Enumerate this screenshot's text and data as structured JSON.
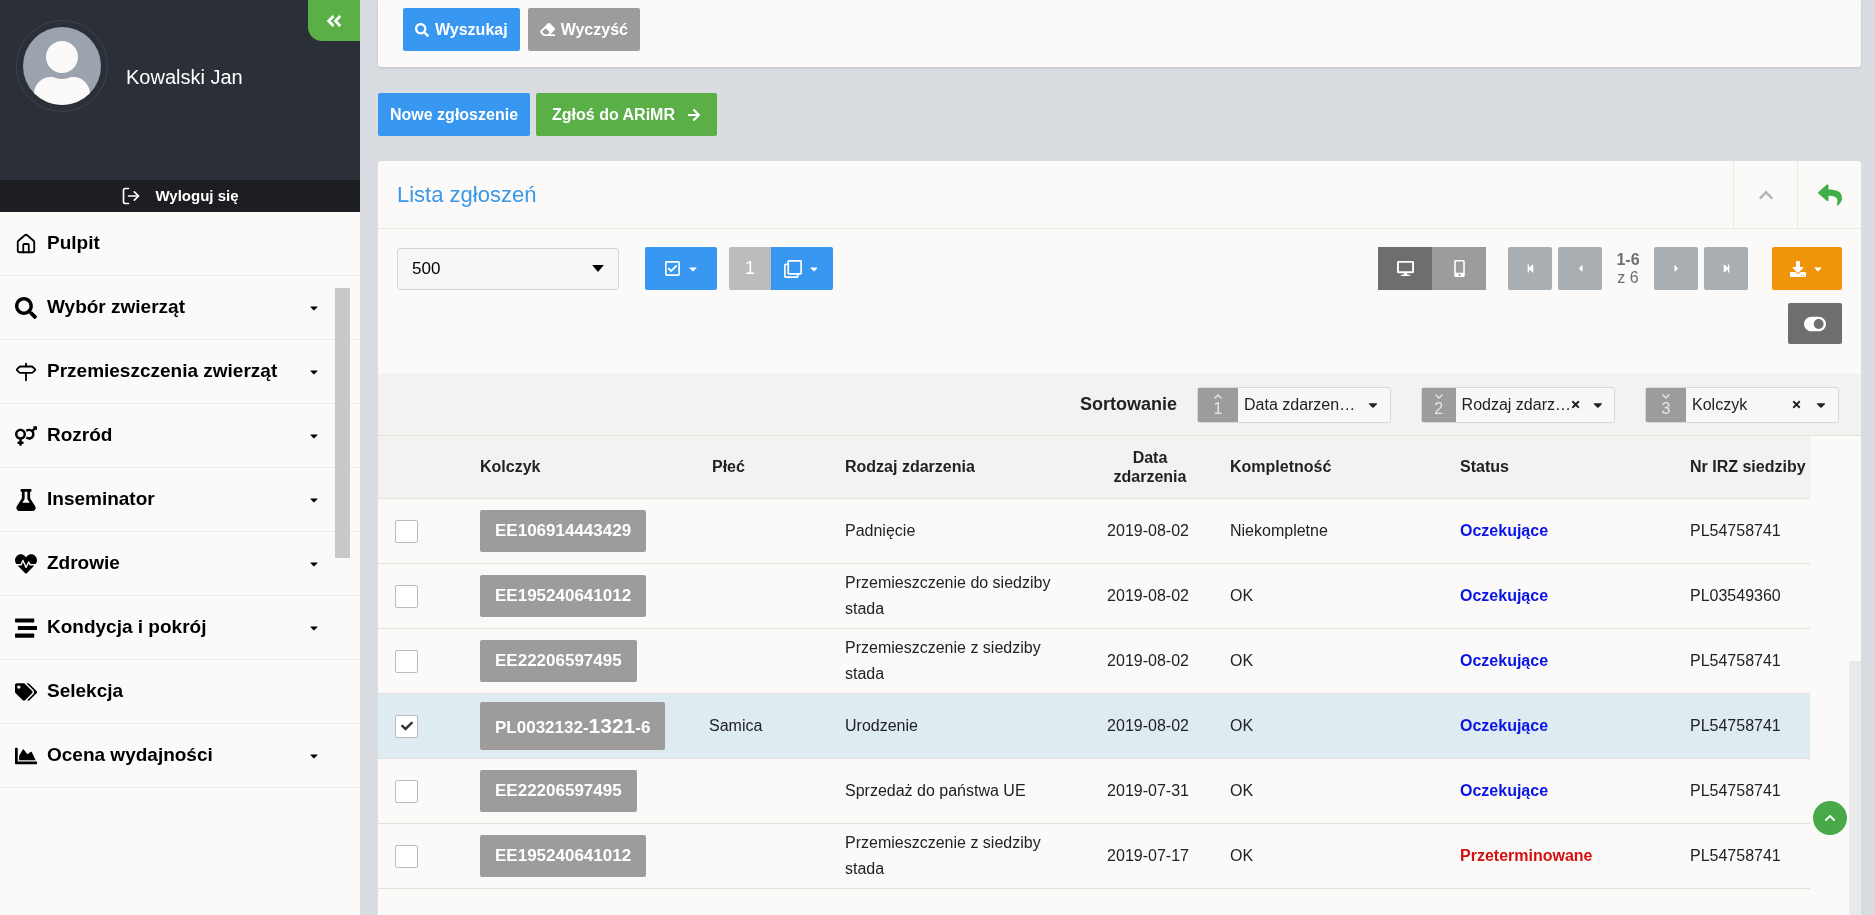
{
  "sidebar": {
    "user_name": "Kowalski Jan",
    "logout": "Wyloguj się",
    "items": [
      {
        "label": "Pulpit",
        "has_submenu": false
      },
      {
        "label": "Wybór zwierząt",
        "has_submenu": true
      },
      {
        "label": "Przemieszczenia zwierząt",
        "has_submenu": true
      },
      {
        "label": "Rozród",
        "has_submenu": true
      },
      {
        "label": "Inseminator",
        "has_submenu": true
      },
      {
        "label": "Zdrowie",
        "has_submenu": true
      },
      {
        "label": "Kondycja i pokrój",
        "has_submenu": true
      },
      {
        "label": "Selekcja",
        "has_submenu": false
      },
      {
        "label": "Ocena wydajności",
        "has_submenu": true
      }
    ]
  },
  "search_buttons": [
    "Wyszukaj",
    "Wyczyść"
  ],
  "actions": [
    "Nowe zgłoszenie",
    "Zgłoś do ARiMR"
  ],
  "panel": {
    "title": "Lista zgłoszeń",
    "page_size": "500",
    "selected_count": "1",
    "views": [
      {
        "selected": true
      },
      {
        "selected": false
      }
    ],
    "page_range": "1-6",
    "page_total": "z 6",
    "sort_label": "Sortowanie",
    "sorts": [
      {
        "number": "1",
        "ascending": true,
        "label": "Data zdarzen…",
        "clearable": false
      },
      {
        "number": "2",
        "ascending": false,
        "label": "Rodzaj zdarz…",
        "clearable": true
      },
      {
        "number": "3",
        "ascending": false,
        "label": "Kolczyk",
        "clearable": true
      }
    ],
    "columns": [
      "Kolczyk",
      "Płeć",
      "Rodzaj zdarzenia",
      "Data zdarzenia",
      "Kompletność",
      "Status",
      "Nr IRZ siedziby"
    ],
    "rows": [
      {
        "selected": false,
        "tag": "EE106914443429",
        "sex": "",
        "event": "Padnięcie",
        "date": "2019-08-02",
        "completeness": "Niekompletne",
        "status": "Oczekujące",
        "overdue": false,
        "irz": "PL54758741"
      },
      {
        "selected": false,
        "tag": "EE195240641012",
        "sex": "",
        "event": "Przemieszczenie do siedziby stada",
        "date": "2019-08-02",
        "completeness": "OK",
        "status": "Oczekujące",
        "overdue": false,
        "irz": "PL03549360"
      },
      {
        "selected": false,
        "tag": "EE22206597495",
        "sex": "",
        "event": "Przemieszczenie z siedziby stada",
        "date": "2019-08-02",
        "completeness": "OK",
        "status": "Oczekujące",
        "overdue": false,
        "irz": "PL54758741"
      },
      {
        "selected": true,
        "tag": "PL0032132-**1321**-6",
        "sex": "Samica",
        "event": "Urodzenie",
        "date": "2019-08-02",
        "completeness": "OK",
        "status": "Oczekujące",
        "overdue": false,
        "irz": "PL54758741"
      },
      {
        "selected": false,
        "tag": "EE22206597495",
        "sex": "",
        "event": "Sprzedaż do państwa UE",
        "date": "2019-07-31",
        "completeness": "OK",
        "status": "Oczekujące",
        "overdue": false,
        "irz": "PL54758741"
      },
      {
        "selected": false,
        "tag": "EE195240641012",
        "sex": "",
        "event": "Przemieszczenie z siedziby stada",
        "date": "2019-07-17",
        "completeness": "OK",
        "status": "Przeterminowane",
        "overdue": true,
        "irz": "PL54758741"
      }
    ]
  }
}
